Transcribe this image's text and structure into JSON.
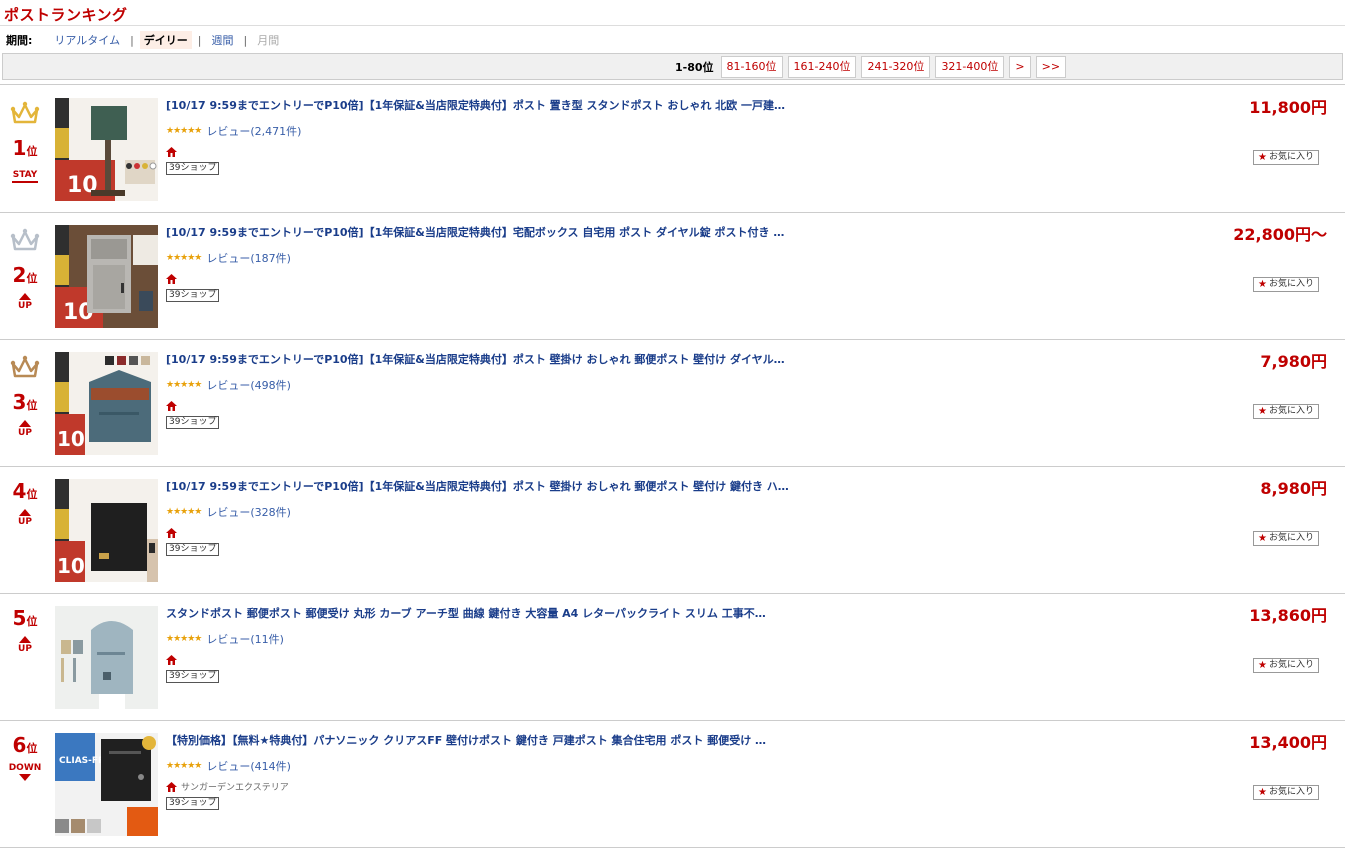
{
  "page": {
    "title": "ポストランキング"
  },
  "period": {
    "label": "期間:",
    "options": [
      {
        "label": "リアルタイム",
        "state": "link"
      },
      {
        "label": "デイリー",
        "state": "active"
      },
      {
        "label": "週間",
        "state": "link"
      },
      {
        "label": "月間",
        "state": "disabled"
      }
    ],
    "separator": "|"
  },
  "pager": {
    "current": "1-80位",
    "pages": [
      "81-160位",
      "161-240位",
      "241-320位",
      "321-400位",
      ">",
      ">>"
    ]
  },
  "common": {
    "fav_label": "お気に入り",
    "badge_39": "39ショップ",
    "stars_glyph": "★★★★★",
    "rank_suffix": "位"
  },
  "colors": {
    "accent_red": "#bf0000",
    "link_blue": "#1a3d8a",
    "gold": "#e3b53a",
    "silver": "#b7bfc9",
    "bronze": "#b88a55"
  },
  "items": [
    {
      "rank": "1",
      "status": "STAY",
      "crown": "gold",
      "name": "[10/17 9:59までエントリーでP10倍]【1年保証&当店限定特典付】ポスト 置き型 スタンドポスト おしゃれ 北欧 一戸建…",
      "review": "レビュー(2,471件)",
      "shop": "",
      "price": "11,800円",
      "thumb_icon": "stand-post-thumbnail"
    },
    {
      "rank": "2",
      "status": "UP",
      "crown": "silver",
      "name": "[10/17 9:59までエントリーでP10倍]【1年保証&当店限定特典付】宅配ボックス 自宅用 ポスト ダイヤル錠 ポスト付き …",
      "review": "レビュー(187件)",
      "shop": "",
      "price": "22,800円〜",
      "thumb_icon": "delivery-box-thumbnail"
    },
    {
      "rank": "3",
      "status": "UP",
      "crown": "bronze",
      "name": "[10/17 9:59までエントリーでP10倍]【1年保証&当店限定特典付】ポスト 壁掛け おしゃれ 郵便ポスト 壁付け ダイヤル…",
      "review": "レビュー(498件)",
      "shop": "",
      "price": "7,980円",
      "thumb_icon": "wall-post-thumbnail"
    },
    {
      "rank": "4",
      "status": "UP",
      "crown": "",
      "name": "[10/17 9:59までエントリーでP10倍]【1年保証&当店限定特典付】ポスト 壁掛け おしゃれ 郵便ポスト 壁付け 鍵付き ハ…",
      "review": "レビュー(328件)",
      "shop": "",
      "price": "8,980円",
      "thumb_icon": "black-wall-post-thumbnail"
    },
    {
      "rank": "5",
      "status": "UP",
      "crown": "",
      "name": "スタンドポスト 郵便ポスト 郵便受け 丸形 カーブ アーチ型 曲線 鍵付き 大容量 A4 レターパックライト スリム 工事不…",
      "review": "レビュー(11件)",
      "shop": "",
      "price": "13,860円",
      "thumb_icon": "arch-stand-post-thumbnail"
    },
    {
      "rank": "6",
      "status": "DOWN",
      "crown": "",
      "name": "【特別価格】【無料★特典付】パナソニック クリアスFF 壁付けポスト 鍵付き 戸建ポスト 集合住宅用 ポスト 郵便受け …",
      "review": "レビュー(414件)",
      "shop": "サンガーデンエクステリア",
      "price": "13,400円",
      "thumb_icon": "panasonic-post-thumbnail"
    }
  ]
}
